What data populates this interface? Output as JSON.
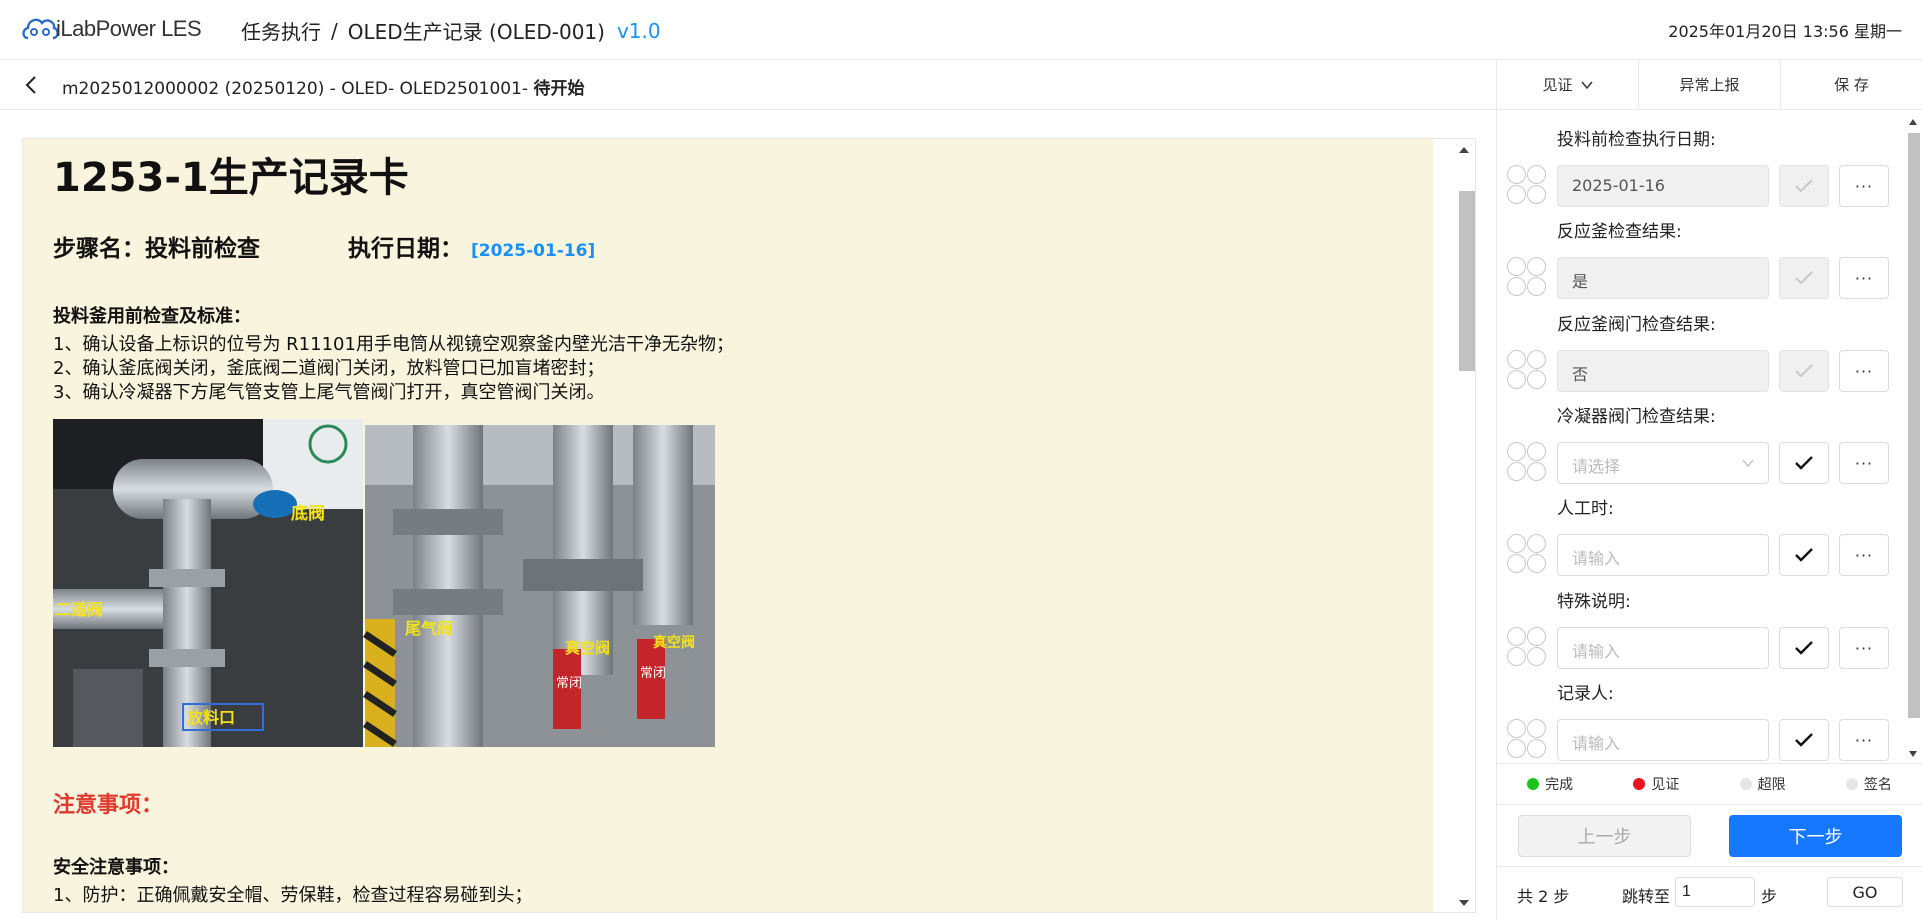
{
  "header": {
    "logo_text": "iLabPower LES",
    "breadcrumb_task": "任务执行",
    "breadcrumb_sep": "/",
    "breadcrumb_record": "OLED生产记录 (OLED-001)",
    "version": "v1.0",
    "datetime": "2025年01月20日 13:56 星期一"
  },
  "subheader": {
    "title": "m2025012000002 (20250120) - OLED- OLED2501001- ",
    "status": "待开始"
  },
  "actions": {
    "witness": "见证",
    "report": "异常上报",
    "save": "保 存"
  },
  "document": {
    "title": "1253-1生产记录卡",
    "step_label": "步骤名：投料前检查",
    "date_label": "执行日期：",
    "date_value": "[2025-01-16]",
    "section_title": "投料釜用前检查及标准：",
    "lines": [
      "1、确认设备上标识的位号为 R11101用手电筒从视镜空观察釜内壁光洁干净无杂物；",
      "2、确认釜底阀关闭，釜底阀二道阀门关闭，放料管口已加盲堵密封；",
      "3、确认冷凝器下方尾气管支管上尾气管阀门打开，真空管阀门关闭。"
    ],
    "photo_labels": [
      "底阀",
      "二道阀",
      "放料口",
      "尾气阀",
      "真空阀",
      "真空阀",
      "常闭",
      "常闭"
    ],
    "caution_title": "注意事项：",
    "safety_title": "安全注意事项：",
    "safety_line": "1、防护：正确佩戴安全帽、劳保鞋，检查过程容易碰到头；"
  },
  "form": {
    "fields": [
      {
        "label": "投料前检查执行日期:",
        "value": "2025-01-16",
        "placeholder": "",
        "filled": true,
        "type": "date"
      },
      {
        "label": "反应釜检查结果:",
        "value": "是",
        "placeholder": "",
        "filled": true,
        "type": "select"
      },
      {
        "label": "反应釜阀门检查结果:",
        "value": "否",
        "placeholder": "",
        "filled": true,
        "type": "select"
      },
      {
        "label": "冷凝器阀门检查结果:",
        "value": "",
        "placeholder": "请选择",
        "filled": false,
        "type": "select"
      },
      {
        "label": "人工时:",
        "value": "",
        "placeholder": "请输入",
        "filled": false,
        "type": "text"
      },
      {
        "label": "特殊说明:",
        "value": "",
        "placeholder": "请输入",
        "filled": false,
        "type": "text"
      },
      {
        "label": "记录人:",
        "value": "",
        "placeholder": "请输入",
        "filled": false,
        "type": "text"
      }
    ],
    "more_label": "···"
  },
  "legend": {
    "items": [
      {
        "label": "完成",
        "color": "#1dc21d"
      },
      {
        "label": "见证",
        "color": "#e8141e"
      },
      {
        "label": "超限",
        "color": "#e6e6e6"
      },
      {
        "label": "签名",
        "color": "#e6e6e6"
      }
    ]
  },
  "nav": {
    "prev": "上一步",
    "next": "下一步"
  },
  "pager": {
    "total": "共 2 步",
    "jump": "跳转至",
    "page_value": "1",
    "unit": "步",
    "go": "GO"
  },
  "colors": {
    "accent": "#1677ff",
    "doc_bg": "#f8f4dd",
    "caution": "#e03a2f"
  }
}
